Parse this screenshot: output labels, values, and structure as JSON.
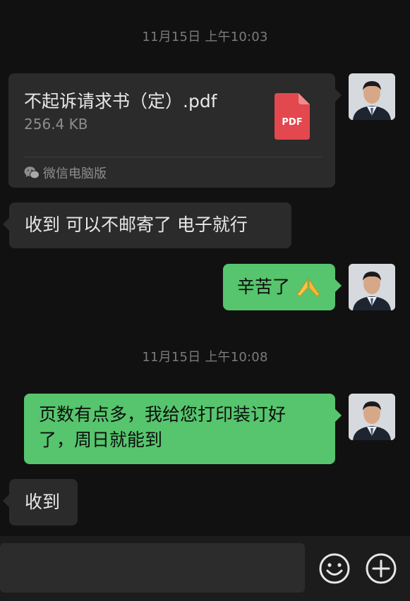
{
  "chat": {
    "timestamp_1": "11月15日 上午10:03",
    "file_message": {
      "file_name": "不起诉请求书（定）.pdf",
      "file_size": "256.4 KB",
      "file_badge": "PDF",
      "source_label": "微信电脑版"
    },
    "message_2": "收到 可以不邮寄了 电子就行",
    "message_3": "辛苦了",
    "message_3_emoji": "prayer-hands-emoji",
    "timestamp_2": "11月15日 上午10:08",
    "message_4_line1": "页数有点多，我给您打印装订好",
    "message_4_line2": "了，周日就能到",
    "message_5": "收到"
  },
  "input_bar": {
    "emoji_button_icon": "smiley-icon",
    "more_button_icon": "plus-circle-icon"
  },
  "colors": {
    "background": "#111111",
    "incoming_bubble": "#2b2b2b",
    "outgoing_bubble": "#56c56d",
    "timestamp_text": "#7b7b7b",
    "pdf_red": "#e2484d"
  }
}
